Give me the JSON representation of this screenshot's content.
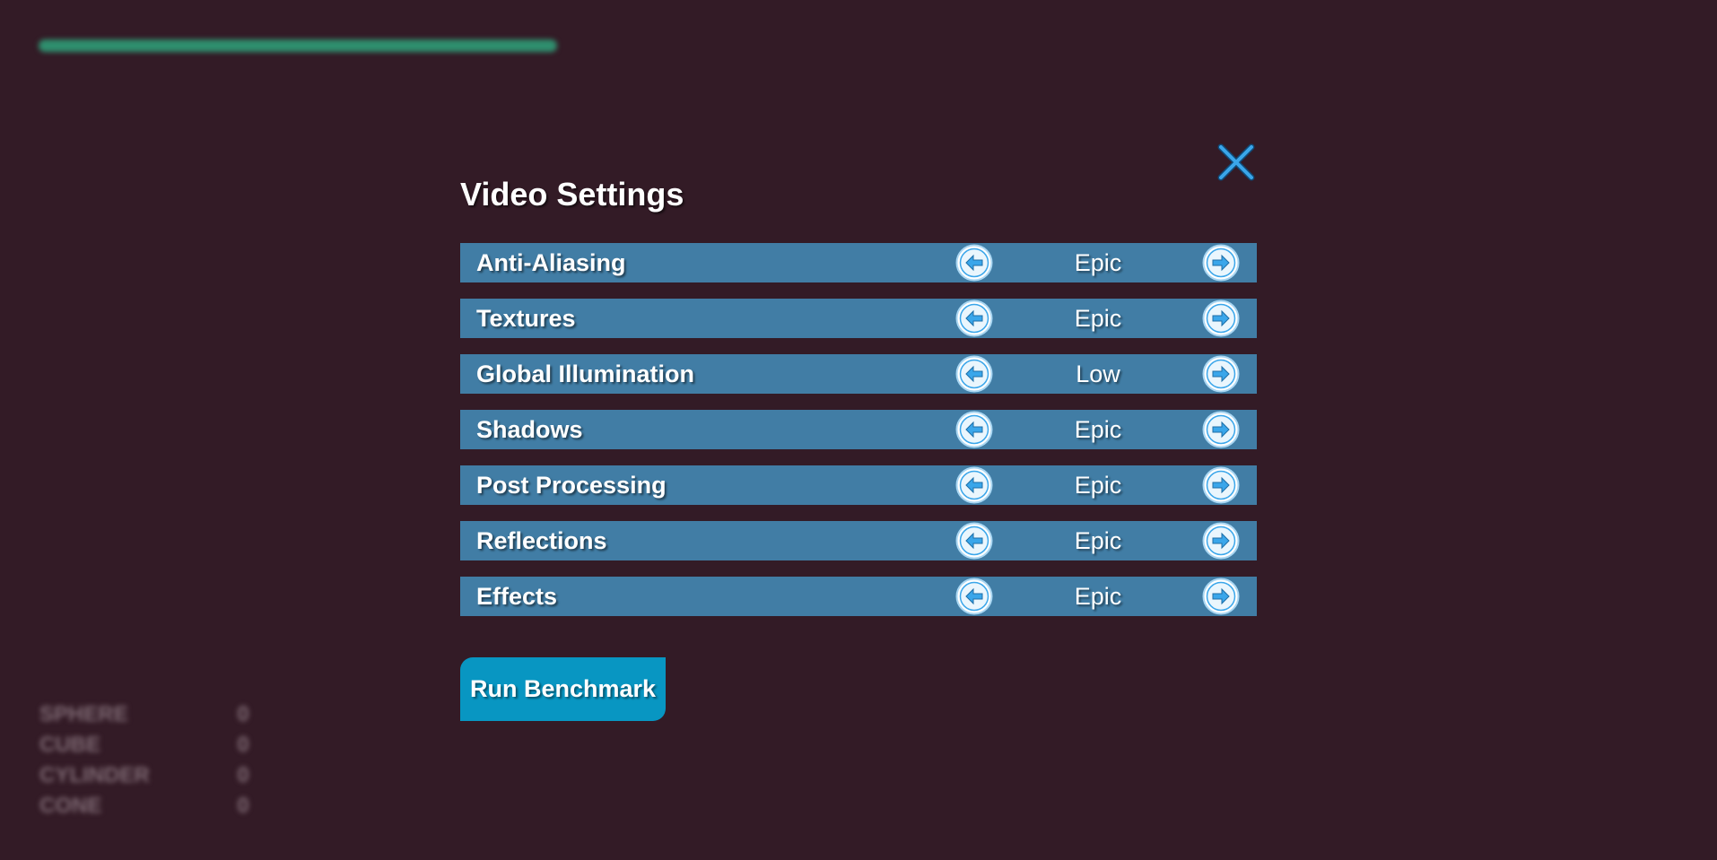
{
  "hud": {
    "progress_fraction": 1.0,
    "progress_color": "#2f8f6e",
    "stats": [
      {
        "label": "SPHERE",
        "value": "0"
      },
      {
        "label": "CUBE",
        "value": "0"
      },
      {
        "label": "CYLINDER",
        "value": "0"
      },
      {
        "label": "CONE",
        "value": "0"
      }
    ]
  },
  "dialog": {
    "title": "Video Settings",
    "close_icon": "close-icon",
    "settings": [
      {
        "label": "Anti-Aliasing",
        "value": "Epic"
      },
      {
        "label": "Textures",
        "value": "Epic"
      },
      {
        "label": "Global Illumination",
        "value": "Low"
      },
      {
        "label": "Shadows",
        "value": "Epic"
      },
      {
        "label": "Post Processing",
        "value": "Epic"
      },
      {
        "label": "Reflections",
        "value": "Epic"
      },
      {
        "label": "Effects",
        "value": "Epic"
      }
    ],
    "benchmark_label": "Run Benchmark"
  },
  "colors": {
    "background": "#331b26",
    "row": "#417da5",
    "button": "#0896c2",
    "icon_accent": "#3aa6ea"
  }
}
